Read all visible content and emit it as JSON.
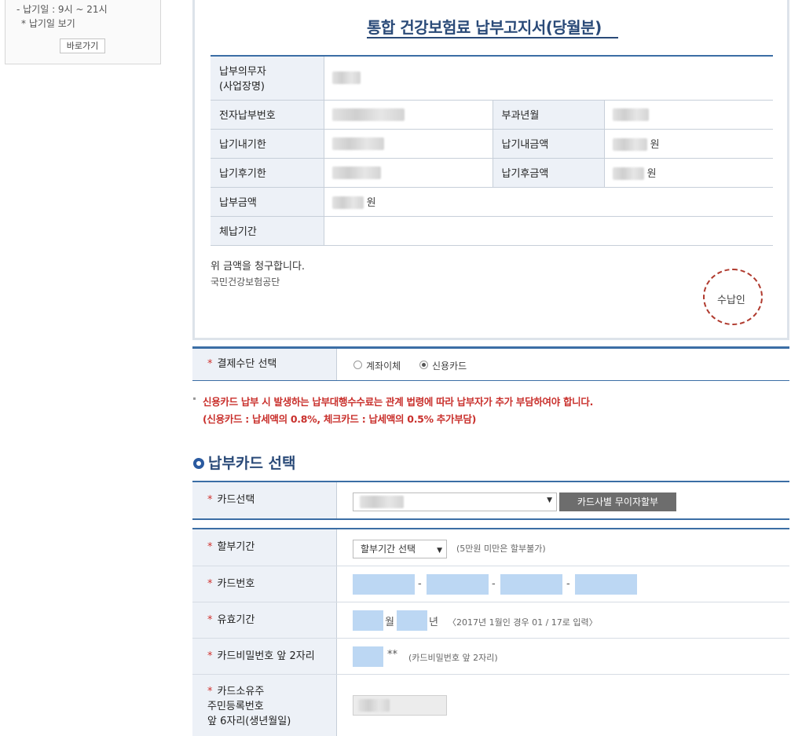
{
  "sidebar": {
    "line1": "- 납기일 : 9시 ~ 21시",
    "line2": "* 납기일 보기",
    "go_button": "바로가기"
  },
  "bill": {
    "title": "통합 건강보험료 납부고지서(당월분)",
    "rows": {
      "payer_label_1": "납부의무자",
      "payer_label_2": "(사업장명)",
      "epay_no_label": "전자납부번호",
      "charge_month_label": "부과년월",
      "due_date_label": "납기내기한",
      "due_amount_label": "납기내금액",
      "late_date_label": "납기후기한",
      "late_amount_label": "납기후금액",
      "pay_amount_label": "납부금액",
      "overdue_label": "체납기간",
      "won": "원"
    },
    "claim_text": "위 금액을 청구합니다.",
    "org_name": "국민건강보험공단",
    "stamp_label": "수납인"
  },
  "payment_method": {
    "label": "결제수단 선택",
    "required_mark": "*",
    "options": [
      {
        "label": "계좌이체",
        "selected": false
      },
      {
        "label": "신용카드",
        "selected": true
      }
    ]
  },
  "notice": {
    "line1": "신용카드 납부 시 발생하는 납부대행수수료는 관계 법령에 따라 납부자가 추가 부담하여야 합니다.",
    "line2": "(신용카드 : 납세액의 0.8%, 체크카드 : 납세액의 0.5% 추가부담)"
  },
  "card_section": {
    "title": "납부카드 선택",
    "card_select_label": "카드선택",
    "card_select_arrow": "▼",
    "installment_button": "카드사별 무이자할부"
  },
  "form": {
    "installment_label": "할부기간",
    "installment_value": "할부기간 선택",
    "installment_arrow": "▼",
    "installment_hint": "(5만원 미만은 할부불가)",
    "card_number_label": "카드번호",
    "dash": "-",
    "expiry_label": "유효기간",
    "month_unit": "월",
    "year_unit": "년",
    "expiry_hint": "〈2017년 1월인 경우 01 / 17로 입력〉",
    "pin_label": "카드비밀번호 앞 2자리",
    "pin_stars": "**",
    "pin_hint": "(카드비밀번호 앞 2자리)",
    "owner_label_1": "카드소유주",
    "owner_label_2": "주민등록번호",
    "owner_label_3": "앞 6자리(생년월일)"
  },
  "colors": {
    "accent_blue": "#3b6ea5",
    "title_blue": "#2a4a78",
    "warning_red": "#c9302c",
    "input_blue": "#bcd7f3"
  }
}
